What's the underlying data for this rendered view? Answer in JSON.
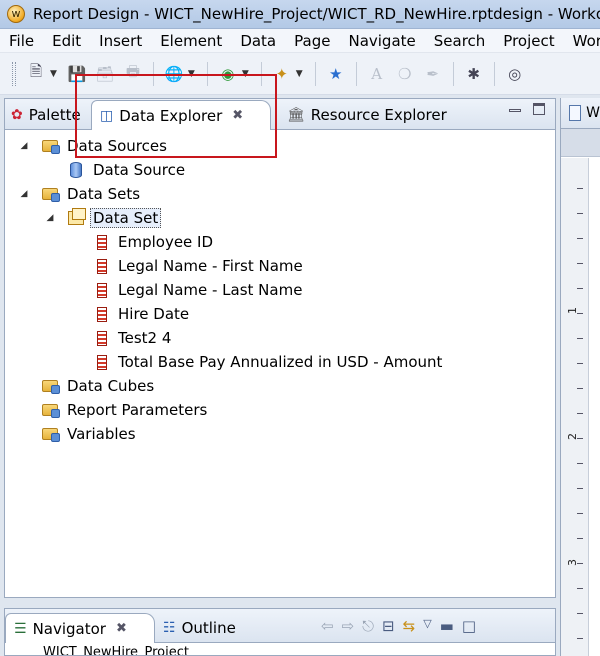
{
  "window": {
    "title": "Report Design - WICT_NewHire_Project/WICT_RD_NewHire.rptdesign - Workday"
  },
  "menubar": {
    "items": [
      "File",
      "Edit",
      "Insert",
      "Element",
      "Data",
      "Page",
      "Navigate",
      "Search",
      "Project",
      "Workday"
    ]
  },
  "toolbar": {
    "icons": [
      "new-file-icon",
      "save-icon",
      "save-all-icon",
      "print-icon",
      "preview-web-icon",
      "run-report-icon",
      "wand-icon",
      "chart-icon",
      "text-icon",
      "paint-icon",
      "pen-icon",
      "settings-icon",
      "help-icon"
    ]
  },
  "explorer": {
    "tabs": {
      "palette": "Palette",
      "data_explorer": "Data Explorer",
      "resource_explorer": "Resource Explorer"
    },
    "tree": {
      "data_sources": "Data Sources",
      "data_source": "Data Source",
      "data_sets": "Data Sets",
      "data_set": "Data Set",
      "fields": [
        "Employee ID",
        "Legal Name - First Name",
        "Legal Name - Last Name",
        "Hire Date",
        "Test2 4",
        "Total Base Pay Annualized in USD - Amount"
      ],
      "data_cubes": "Data Cubes",
      "report_parameters": "Report Parameters",
      "variables": "Variables"
    }
  },
  "editor": {
    "tab_label": "W",
    "ruler_labels": [
      "1",
      "2",
      "3"
    ]
  },
  "bottom": {
    "tabs": {
      "navigator": "Navigator",
      "outline": "Outline"
    },
    "project": "WICT_NewHire_Project"
  }
}
